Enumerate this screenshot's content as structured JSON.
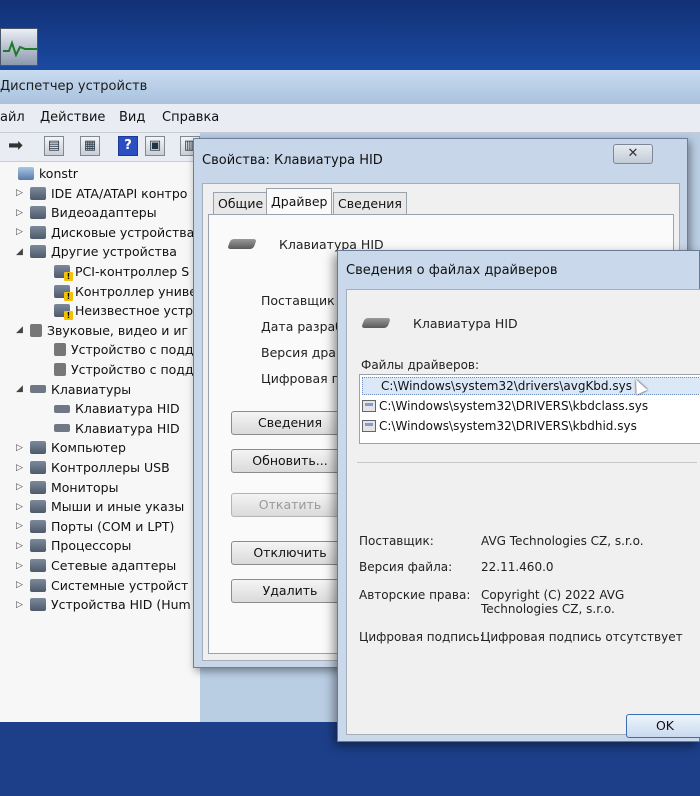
{
  "device_manager": {
    "title": "Диспетчер устройств",
    "menu": [
      "айл",
      "Действие",
      "Вид",
      "Справка"
    ],
    "tree": [
      {
        "label": "konstr",
        "level": 0,
        "icon": "computer-icon",
        "expander": ""
      },
      {
        "label": "IDE ATA/ATAPI контро",
        "level": 1,
        "icon": "ide-controller-icon",
        "expander": "▷"
      },
      {
        "label": "Видеоадаптеры",
        "level": 1,
        "icon": "display-adapter-icon",
        "expander": "▷"
      },
      {
        "label": "Дисковые устройства",
        "level": 1,
        "icon": "disk-drive-icon",
        "expander": "▷"
      },
      {
        "label": "Другие устройства",
        "level": 1,
        "icon": "other-devices-icon",
        "expander": "◢"
      },
      {
        "label": "PCI-контроллер S",
        "level": 2,
        "icon": "unknown-device-warning-icon",
        "expander": ""
      },
      {
        "label": "Контроллер униве",
        "level": 2,
        "icon": "unknown-device-warning-icon",
        "expander": ""
      },
      {
        "label": "Неизвестное устр",
        "level": 2,
        "icon": "unknown-device-warning-icon",
        "expander": ""
      },
      {
        "label": "Звуковые, видео и иг",
        "level": 1,
        "icon": "speaker-icon",
        "expander": "◢"
      },
      {
        "label": "Устройство с подд",
        "level": 2,
        "icon": "speaker-icon",
        "expander": ""
      },
      {
        "label": "Устройство с подд",
        "level": 2,
        "icon": "speaker-icon",
        "expander": ""
      },
      {
        "label": "Клавиатуры",
        "level": 1,
        "icon": "keyboard-icon",
        "expander": "◢"
      },
      {
        "label": "Клавиатура HID",
        "level": 2,
        "icon": "keyboard-icon",
        "expander": ""
      },
      {
        "label": "Клавиатура HID",
        "level": 2,
        "icon": "keyboard-icon",
        "expander": ""
      },
      {
        "label": "Компьютер",
        "level": 1,
        "icon": "computer-icon",
        "expander": "▷"
      },
      {
        "label": "Контроллеры USB",
        "level": 1,
        "icon": "usb-icon",
        "expander": "▷"
      },
      {
        "label": "Мониторы",
        "level": 1,
        "icon": "monitor-icon",
        "expander": "▷"
      },
      {
        "label": "Мыши и иные указы",
        "level": 1,
        "icon": "mouse-icon",
        "expander": "▷"
      },
      {
        "label": "Порты (COM и LPT)",
        "level": 1,
        "icon": "port-icon",
        "expander": "▷"
      },
      {
        "label": "Процессоры",
        "level": 1,
        "icon": "processor-icon",
        "expander": "▷"
      },
      {
        "label": "Сетевые адаптеры",
        "level": 1,
        "icon": "network-adapter-icon",
        "expander": "▷"
      },
      {
        "label": "Системные устройст",
        "level": 1,
        "icon": "system-device-icon",
        "expander": "▷"
      },
      {
        "label": "Устройства HID (Hum",
        "level": 1,
        "icon": "hid-device-icon",
        "expander": "▷"
      }
    ]
  },
  "properties_dialog": {
    "title": "Свойства: Клавиатура HID",
    "close_glyph": "✕",
    "tabs": [
      "Общие",
      "Драйвер",
      "Сведения"
    ],
    "active_tab": "Драйвер",
    "device_name": "Клавиатура HID",
    "fields": [
      "Поставщик д",
      "Дата разраб",
      "Версия драй",
      "Цифровая по"
    ],
    "buttons": {
      "details": "Сведения",
      "update": "Обновить...",
      "rollback": "Откатить",
      "disable": "Отключить",
      "remove": "Удалить"
    }
  },
  "driver_files_dialog": {
    "title": "Сведения о файлах драйверов",
    "device_name": "Клавиатура HID",
    "files_label": "Файлы драйверов:",
    "files": [
      "C:\\Windows\\system32\\drivers\\avgKbd.sys",
      "C:\\Windows\\system32\\DRIVERS\\kbdclass.sys",
      "C:\\Windows\\system32\\DRIVERS\\kbdhid.sys"
    ],
    "selected_file_index": 0,
    "provider_label": "Поставщик:",
    "provider_value": "AVG Technologies CZ, s.r.o.",
    "version_label": "Версия файла:",
    "version_value": "22.11.460.0",
    "copyright_label": "Авторские права:",
    "copyright_value": "Copyright (C) 2022 AVG Technologies CZ, s.r.o.",
    "signature_label": "Цифровая подпись:",
    "signature_value": "Цифровая подпись отсутствует",
    "ok_label": "OK"
  }
}
